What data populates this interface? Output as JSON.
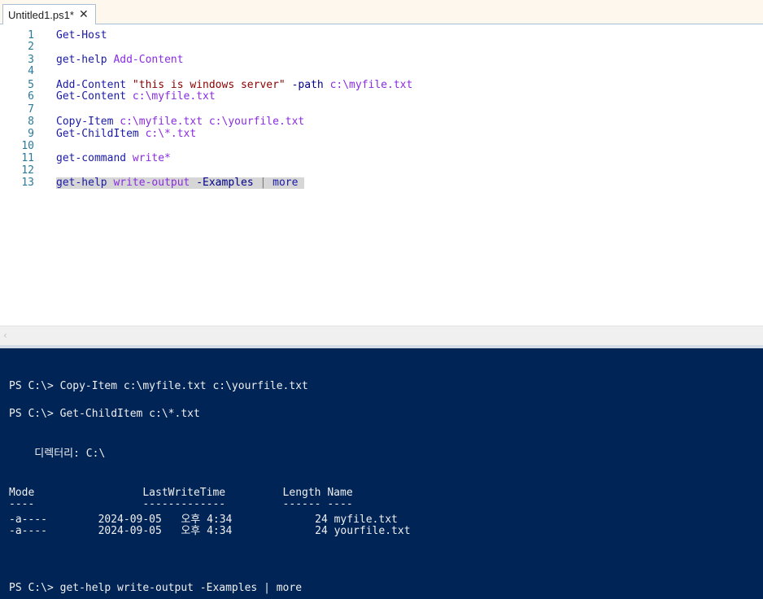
{
  "tab": {
    "title": "Untitled1.ps1*",
    "close_glyph": "✕"
  },
  "editor": {
    "lines": [
      {
        "num": "1",
        "tokens": [
          {
            "t": "Get-Host",
            "c": "cmd"
          }
        ]
      },
      {
        "num": "2",
        "tokens": []
      },
      {
        "num": "3",
        "tokens": [
          {
            "t": "get-help",
            "c": "cmd"
          },
          {
            "t": " ",
            "c": "op"
          },
          {
            "t": "Add-Content",
            "c": "arg"
          }
        ]
      },
      {
        "num": "4",
        "tokens": []
      },
      {
        "num": "5",
        "tokens": [
          {
            "t": "Add-Content",
            "c": "cmd"
          },
          {
            "t": " ",
            "c": "op"
          },
          {
            "t": "\"this is windows server\"",
            "c": "str"
          },
          {
            "t": " ",
            "c": "op"
          },
          {
            "t": "-path",
            "c": "param"
          },
          {
            "t": " ",
            "c": "op"
          },
          {
            "t": "c:\\myfile.txt",
            "c": "arg"
          }
        ]
      },
      {
        "num": "6",
        "tokens": [
          {
            "t": "Get-Content",
            "c": "cmd"
          },
          {
            "t": " ",
            "c": "op"
          },
          {
            "t": "c:\\myfile.txt",
            "c": "arg"
          }
        ]
      },
      {
        "num": "7",
        "tokens": []
      },
      {
        "num": "8",
        "tokens": [
          {
            "t": "Copy-Item",
            "c": "cmd"
          },
          {
            "t": " ",
            "c": "op"
          },
          {
            "t": "c:\\myfile.txt",
            "c": "arg"
          },
          {
            "t": " ",
            "c": "op"
          },
          {
            "t": "c:\\yourfile.txt",
            "c": "arg"
          }
        ]
      },
      {
        "num": "9",
        "tokens": [
          {
            "t": "Get-ChildItem",
            "c": "cmd"
          },
          {
            "t": " ",
            "c": "op"
          },
          {
            "t": "c:\\*.txt",
            "c": "arg"
          }
        ]
      },
      {
        "num": "10",
        "tokens": []
      },
      {
        "num": "11",
        "tokens": [
          {
            "t": "get-command",
            "c": "cmd"
          },
          {
            "t": " ",
            "c": "op"
          },
          {
            "t": "write*",
            "c": "arg"
          }
        ]
      },
      {
        "num": "12",
        "tokens": []
      },
      {
        "num": "13",
        "selected": true,
        "tokens": [
          {
            "t": "get-help",
            "c": "cmd"
          },
          {
            "t": " ",
            "c": "op"
          },
          {
            "t": "write-output",
            "c": "arg"
          },
          {
            "t": " ",
            "c": "op"
          },
          {
            "t": "-Examples",
            "c": "param"
          },
          {
            "t": " | ",
            "c": "op"
          },
          {
            "t": "more",
            "c": "cmd"
          }
        ]
      }
    ]
  },
  "scrollbar": {
    "left_arrow": "‹"
  },
  "console": {
    "lines": [
      "PS C:\\> Copy-Item c:\\myfile.txt c:\\yourfile.txt",
      "PS C:\\> Get-ChildItem c:\\*.txt",
      "    디렉터리: C:\\",
      "Mode                 LastWriteTime         Length Name",
      "----                 -------------         ------ ----",
      "-a----        2024-09-05   오후 4:34             24 myfile.txt",
      "-a----        2024-09-05   오후 4:34             24 yourfile.txt",
      "PS C:\\> get-help write-output -Examples | more"
    ]
  },
  "colors": {
    "console_bg": "#012456",
    "console_text": "#f0f0f0",
    "selection": "#d6d6d6",
    "line_number": "#2b7a9a"
  }
}
